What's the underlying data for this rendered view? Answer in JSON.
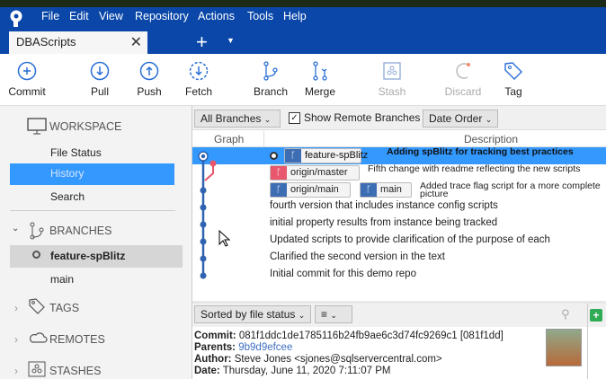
{
  "menu": [
    "File",
    "Edit",
    "View",
    "Repository",
    "Actions",
    "Tools",
    "Help"
  ],
  "tab": {
    "title": "DBAScripts"
  },
  "toolbar": {
    "commit": "Commit",
    "pull": "Pull",
    "push": "Push",
    "fetch": "Fetch",
    "branch": "Branch",
    "merge": "Merge",
    "stash": "Stash",
    "discard": "Discard",
    "tag": "Tag"
  },
  "sidebar": {
    "workspace": "WORKSPACE",
    "file_status": "File Status",
    "history": "History",
    "search": "Search",
    "branches": "BRANCHES",
    "branch_items": [
      "feature-spBlitz",
      "main"
    ],
    "tags": "TAGS",
    "remotes": "REMOTES",
    "stashes": "STASHES"
  },
  "filters": {
    "branches": "All Branches",
    "show_remote": "Show Remote Branches",
    "order": "Date Order"
  },
  "columns": {
    "graph": "Graph",
    "description": "Description"
  },
  "commits": [
    {
      "message": "Adding spBlitz for tracking best practices",
      "refs": [
        "feature-spBlitz"
      ]
    },
    {
      "message": "Fifth change with readme reflecting the new scripts",
      "refs": [
        "origin/master"
      ]
    },
    {
      "message": "Added trace flag script for a more complete picture",
      "refs": [
        "origin/main",
        "main"
      ]
    },
    {
      "message": "fourth version that includes instance config scripts"
    },
    {
      "message": "initial property results from instance being tracked"
    },
    {
      "message": "Updated scripts to provide clarification of the purpose of each"
    },
    {
      "message": "Clarified the second version in the text"
    },
    {
      "message": "Initial commit for this demo repo"
    }
  ],
  "files": {
    "sort": "Sorted by file status"
  },
  "details": {
    "commit_label": "Commit:",
    "commit": "081f1ddc1de1785116b24fb9ae6c3d74fc9269c1 [081f1dd]",
    "parents_label": "Parents:",
    "parents": "9b9d9efcee",
    "author_label": "Author:",
    "author": "Steve Jones <sjones@sqlservercentral.com>",
    "date_label": "Date:",
    "date": "Thursday, June 11, 2020 7:11:07 PM"
  }
}
